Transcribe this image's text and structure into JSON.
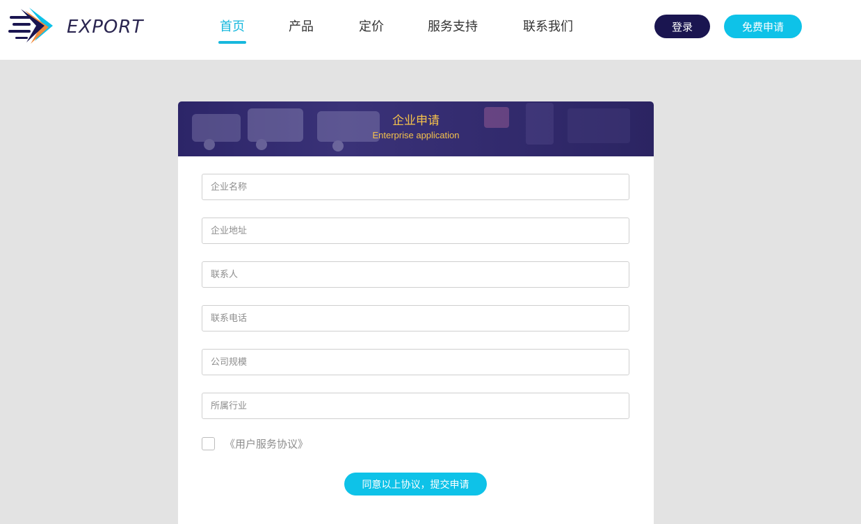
{
  "brand": {
    "name": "EXPORT",
    "logo_icon": "export-arrow-logo",
    "colors": {
      "navy": "#1a1550",
      "cyan": "#0ec2e8",
      "orange": "#f08a3c",
      "gold": "#f5c24b"
    }
  },
  "nav": {
    "items": [
      {
        "label": "首页",
        "active": true
      },
      {
        "label": "产品",
        "active": false
      },
      {
        "label": "定价",
        "active": false
      },
      {
        "label": "服务支持",
        "active": false
      },
      {
        "label": "联系我们",
        "active": false
      }
    ]
  },
  "header_actions": {
    "login_label": "登录",
    "apply_label": "免费申请"
  },
  "form": {
    "title": "企业申请",
    "subtitle": "Enterprise application",
    "fields": [
      {
        "placeholder": "企业名称",
        "value": ""
      },
      {
        "placeholder": "企业地址",
        "value": ""
      },
      {
        "placeholder": "联系人",
        "value": ""
      },
      {
        "placeholder": "联系电话",
        "value": ""
      },
      {
        "placeholder": "公司规模",
        "value": ""
      },
      {
        "placeholder": "所属行业",
        "value": ""
      }
    ],
    "agreement_label": "《用户服务协议》",
    "agreement_checked": false,
    "submit_label": "同意以上协议，提交申请"
  }
}
